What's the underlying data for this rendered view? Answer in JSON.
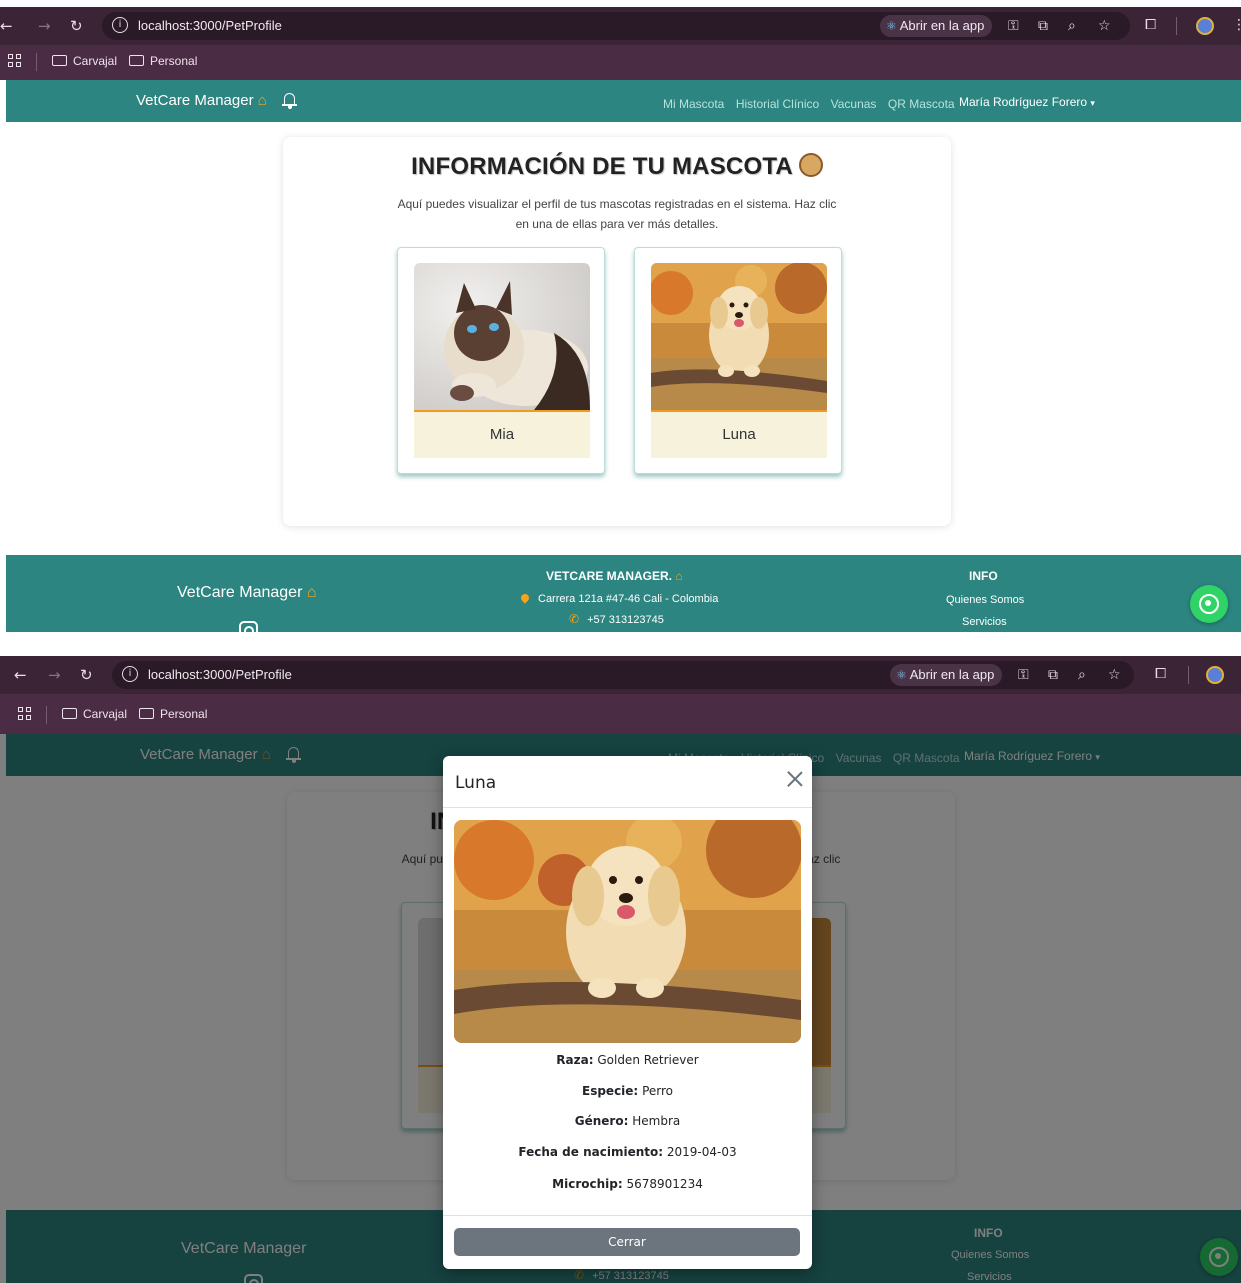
{
  "browser": {
    "url": "localhost:3000/PetProfile",
    "open_app_label": "Abrir en la app",
    "bookmarks": [
      "Carvajal",
      "Personal"
    ]
  },
  "nav": {
    "brand": "VetCare Manager",
    "links": [
      "Mi Mascota",
      "Historial Clínico",
      "Vacunas",
      "QR Mascota"
    ],
    "user": "María Rodríguez Forero",
    "user_caret": "▾"
  },
  "main": {
    "title": "INFORMACIÓN DE TU MASCOTA",
    "description_line1": "Aquí puedes visualizar el perfil de tus mascotas registradas en el sistema. Haz clic",
    "description_line2": "en una de ellas para ver más detalles."
  },
  "pets": [
    {
      "name": "Mia"
    },
    {
      "name": "Luna"
    }
  ],
  "footer": {
    "brand": "VetCare Manager",
    "company_title": "VETCARE MANAGER.",
    "address": "Carrera 121a #47-46 Cali - Colombia",
    "phone": "+57 313123745",
    "info_title": "INFO",
    "info_links": [
      "Quienes Somos",
      "Servicios"
    ]
  },
  "modal": {
    "title": "Luna",
    "details": [
      {
        "label": "Raza:",
        "value": "Golden Retriever"
      },
      {
        "label": "Especie:",
        "value": "Perro"
      },
      {
        "label": "Género:",
        "value": "Hembra"
      },
      {
        "label": "Fecha de nacimiento:",
        "value": "2019-04-03"
      },
      {
        "label": "Microchip:",
        "value": "5678901234"
      }
    ],
    "close_label": "Cerrar"
  },
  "colors": {
    "brand_teal": "#2c8580",
    "browser_dark": "#3a2436",
    "accent_orange": "#f29a1e",
    "whatsapp_green": "#2fd366",
    "button_gray": "#6c757d"
  }
}
